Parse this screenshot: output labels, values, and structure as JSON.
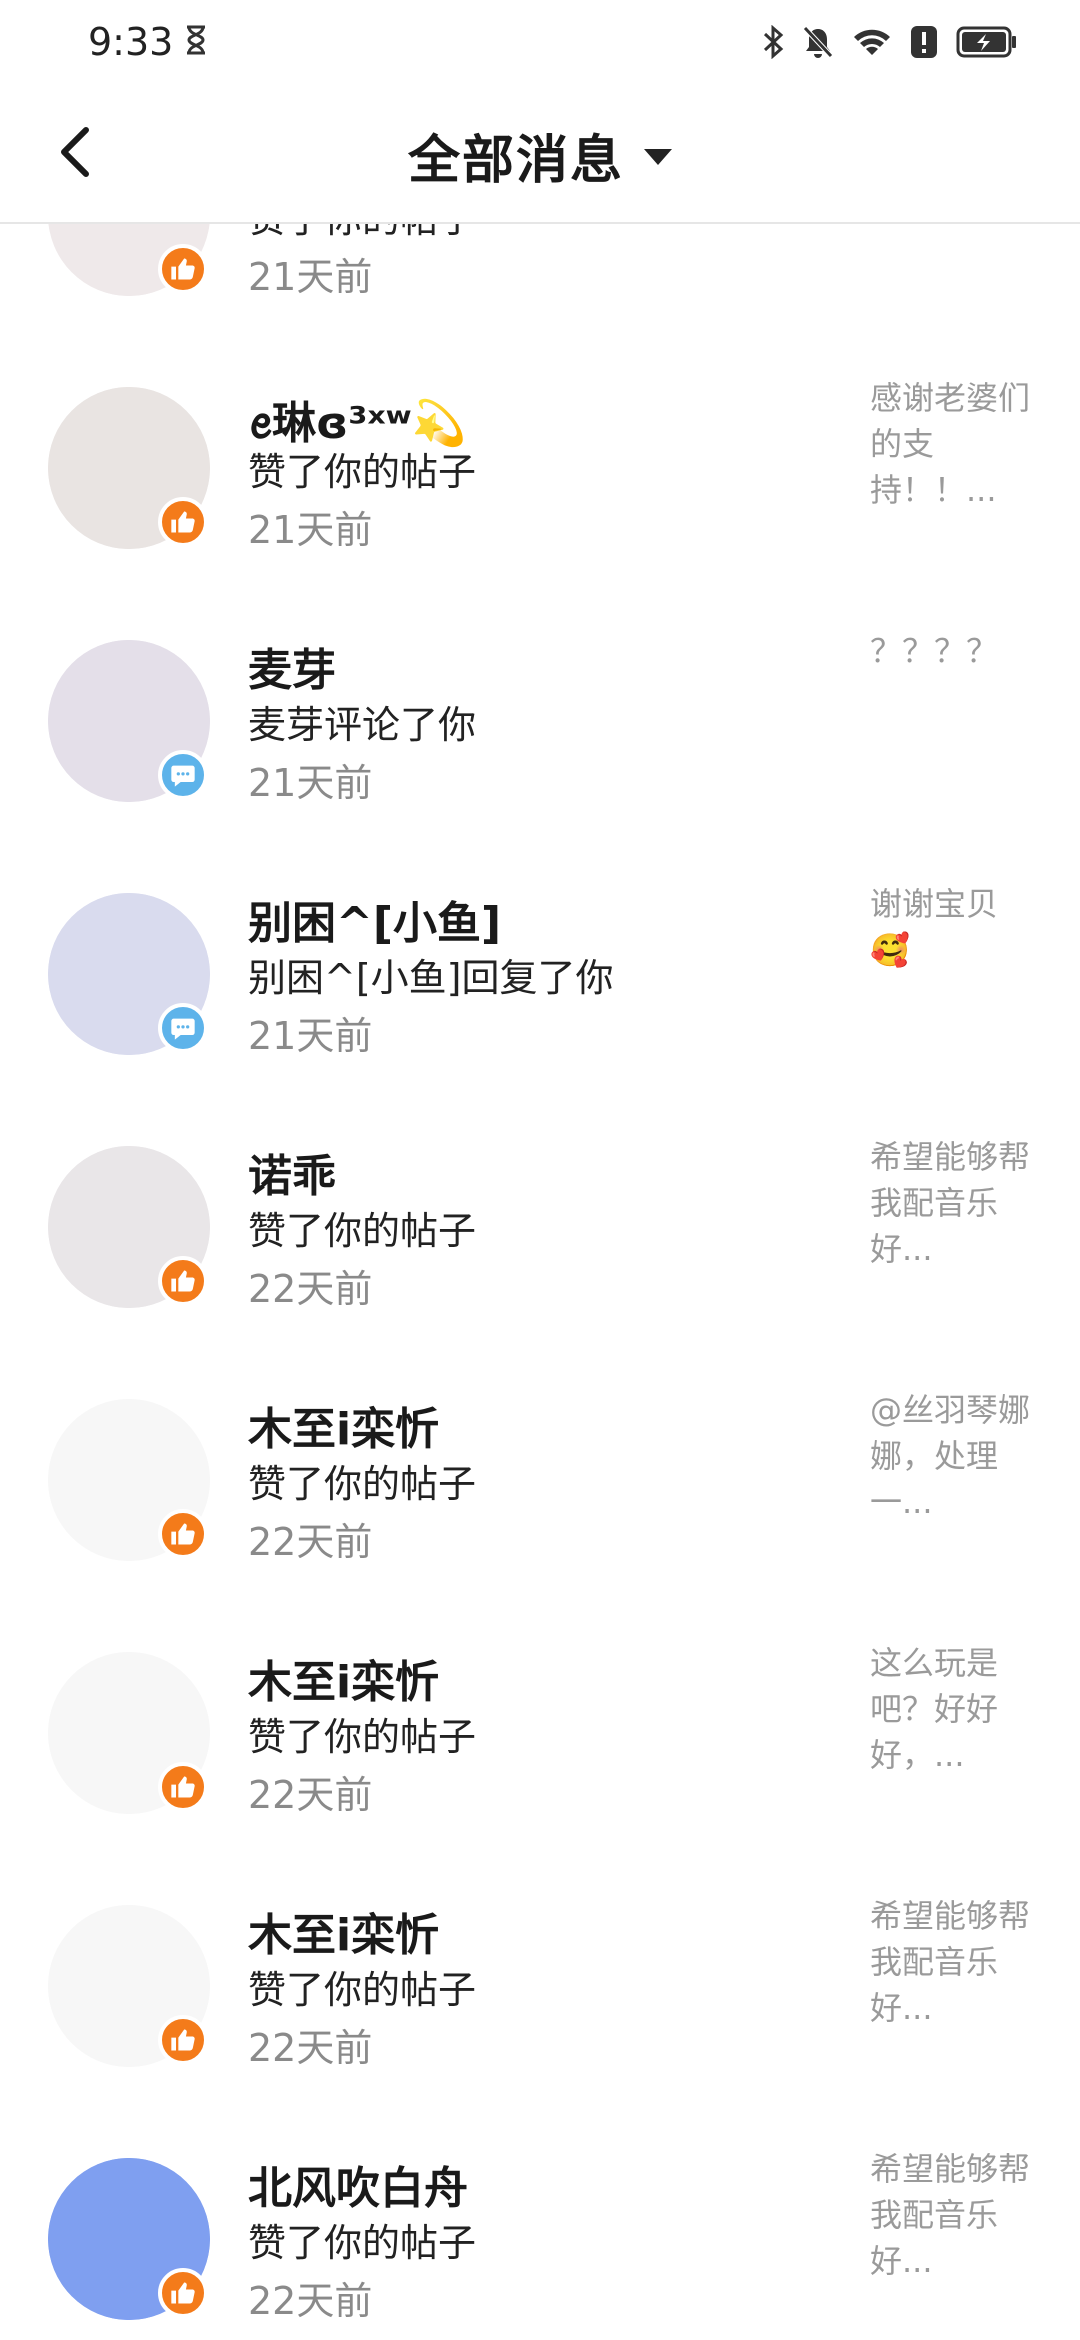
{
  "status_bar": {
    "time": "9:33"
  },
  "header": {
    "title": "全部消息"
  },
  "items": [
    {
      "name": "",
      "action": "赞了你的帖子",
      "time": "21天前",
      "preview": "😁...",
      "badge": "like",
      "avatar_color": "#efe9ea"
    },
    {
      "name": "ꫀ琳ɞ³ˣʷ💫",
      "action": "赞了你的帖子",
      "time": "21天前",
      "preview": "感谢老婆们的支持！！...",
      "badge": "like",
      "avatar_color": "#e9e4e2"
    },
    {
      "name": "麦芽",
      "action": "麦芽评论了你",
      "time": "21天前",
      "preview": "？？？？",
      "badge": "comment",
      "avatar_color": "#e4dfe9"
    },
    {
      "name": "别困^[小鱼]",
      "action": "别困^[小鱼]回复了你",
      "time": "21天前",
      "preview": "谢谢宝贝🥰",
      "badge": "comment",
      "avatar_color": "#d9dbee"
    },
    {
      "name": "诺乖",
      "action": "赞了你的帖子",
      "time": "22天前",
      "preview": "希望能够帮我配音乐好...",
      "badge": "like",
      "avatar_color": "#e9e6e8"
    },
    {
      "name": "木至i栾忻",
      "action": "赞了你的帖子",
      "time": "22天前",
      "preview": "@丝羽琴娜娜，处理一...",
      "badge": "like",
      "avatar_color": "#f7f7f7"
    },
    {
      "name": "木至i栾忻",
      "action": "赞了你的帖子",
      "time": "22天前",
      "preview": "这么玩是吧？好好好，...",
      "badge": "like",
      "avatar_color": "#f7f7f7"
    },
    {
      "name": "木至i栾忻",
      "action": "赞了你的帖子",
      "time": "22天前",
      "preview": "希望能够帮我配音乐好...",
      "badge": "like",
      "avatar_color": "#f7f7f7"
    },
    {
      "name": "北风吹白舟",
      "action": "赞了你的帖子",
      "time": "22天前",
      "preview": "希望能够帮我配音乐好...",
      "badge": "like",
      "avatar_color": "#7f9ff0"
    }
  ],
  "colors": {
    "like_badge": "#f47b1a",
    "comment_badge": "#5db3ea"
  },
  "icons": [
    "hourglass-icon",
    "bluetooth-icon",
    "bell-off-icon",
    "wifi-icon",
    "alert-icon",
    "battery-charging-icon",
    "back-arrow-icon",
    "dropdown-caret-icon",
    "thumbs-up-icon",
    "comment-icon"
  ]
}
